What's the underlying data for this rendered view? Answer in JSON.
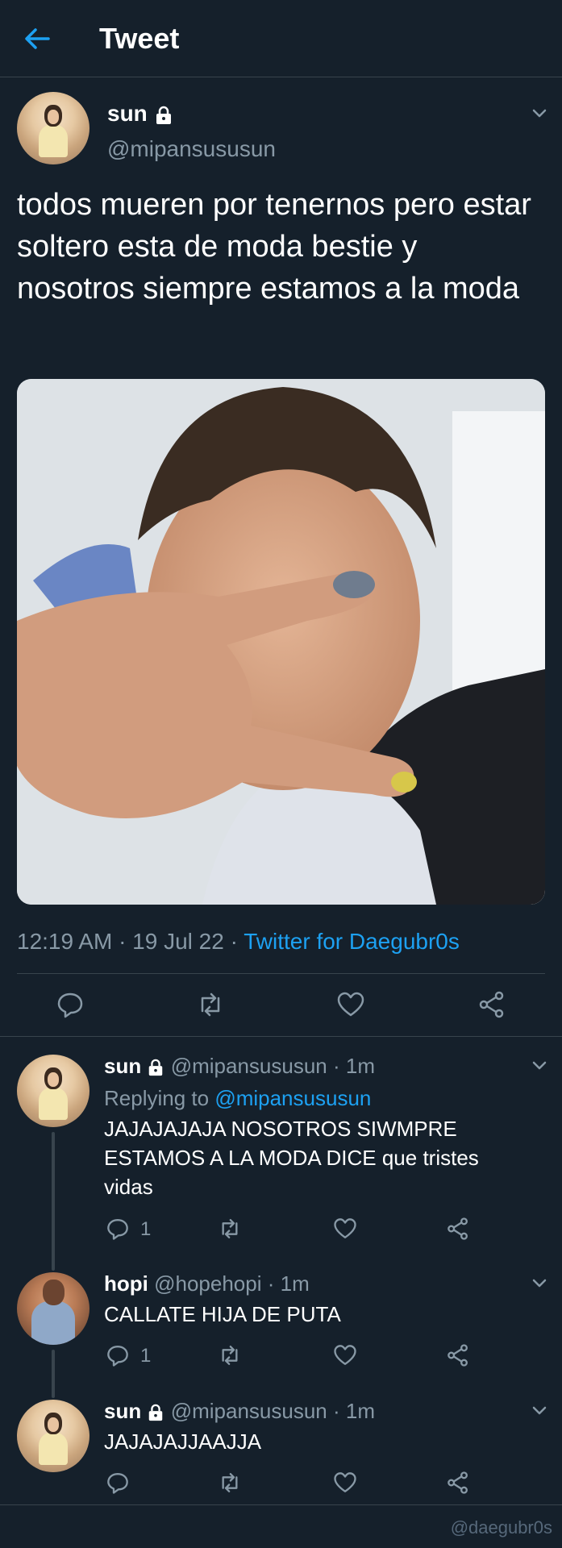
{
  "header": {
    "title": "Tweet"
  },
  "tweet": {
    "name": "sun",
    "handle": "@mipansususun",
    "text": "todos mueren por tenernos pero estar soltero esta de moda bestie y nosotros siempre estamos a la moda",
    "time": "12:19 AM · 19 Jul 22 · ",
    "source": "Twitter for Daegubr0s"
  },
  "replies": [
    {
      "name": "sun",
      "handle": "@mipansususun · 1m",
      "replying_prefix": "Replying to ",
      "replying_handle": "@mipansususun",
      "text": "JAJAJAJAJA NOSOTROS SIWMPRE ESTAMOS A LA MODA DICE que tristes vidas",
      "reply_count": "1"
    },
    {
      "name": "hopi",
      "handle": "@hopehopi · 1m",
      "text": "CALLATE HIJA DE PUTA",
      "reply_count": "1"
    },
    {
      "name": "sun",
      "handle": "@mipansususun · 1m",
      "text": "JAJAJAJJAAJJA"
    }
  ],
  "watermark": "@daegubr0s",
  "colors": {
    "background": "#15202b",
    "accent": "#1da1f2",
    "muted": "#8899a6",
    "divider": "#38444d"
  }
}
